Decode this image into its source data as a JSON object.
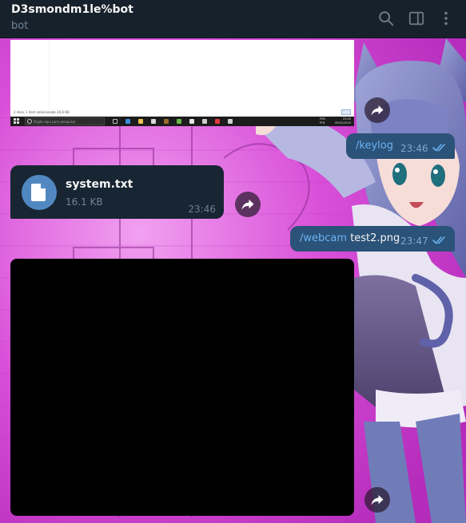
{
  "header": {
    "title": "D3smondm1le%bot",
    "subtitle": "bot"
  },
  "messages": {
    "screenshot": {
      "status_text": "2 itens   1 item selecionado  24,6 KB",
      "search_placeholder": "Digite aqui para pesquisar",
      "lang_line1": "POR",
      "lang_line2": "PTB",
      "clock_time": "23:45",
      "clock_date": "09/02/2019"
    },
    "keylog_command": {
      "text": "/keylog",
      "time": "23:46"
    },
    "file": {
      "name": "system.txt",
      "size": "16.1 KB",
      "time": "23:46"
    },
    "webcam_command": {
      "command": "/webcam",
      "argument": "test2.png",
      "time": "23:47"
    }
  },
  "colors": {
    "header_bg": "#17212b",
    "outgoing_bubble": "#2b5278",
    "incoming_bubble": "#182533",
    "link": "#6ab3f3",
    "wallpaper_magenta": "#d13fd6"
  },
  "icons": {
    "search": "search-icon",
    "sidebar": "sidebar-toggle-icon",
    "menu": "more-vertical-icon",
    "forward": "forward-icon",
    "file": "document-icon",
    "read": "double-check-icon"
  }
}
